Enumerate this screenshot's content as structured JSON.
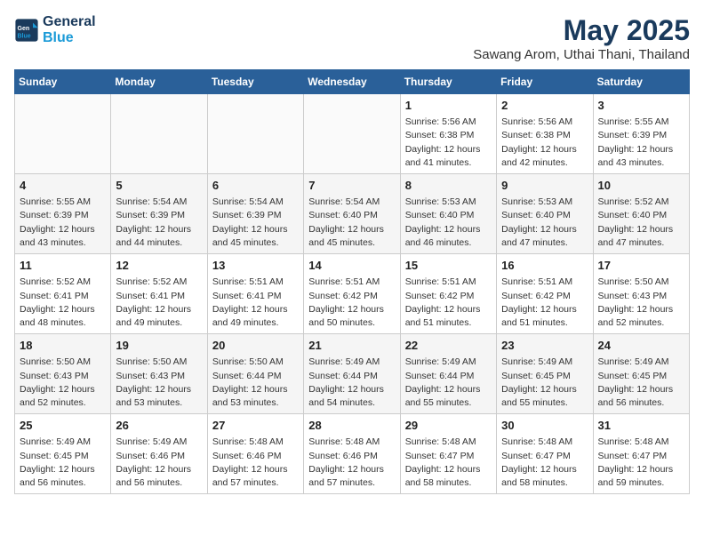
{
  "header": {
    "logo_line1": "General",
    "logo_line2": "Blue",
    "title": "May 2025",
    "subtitle": "Sawang Arom, Uthai Thani, Thailand"
  },
  "weekdays": [
    "Sunday",
    "Monday",
    "Tuesday",
    "Wednesday",
    "Thursday",
    "Friday",
    "Saturday"
  ],
  "weeks": [
    [
      {
        "day": "",
        "info": ""
      },
      {
        "day": "",
        "info": ""
      },
      {
        "day": "",
        "info": ""
      },
      {
        "day": "",
        "info": ""
      },
      {
        "day": "1",
        "info": "Sunrise: 5:56 AM\nSunset: 6:38 PM\nDaylight: 12 hours\nand 41 minutes."
      },
      {
        "day": "2",
        "info": "Sunrise: 5:56 AM\nSunset: 6:38 PM\nDaylight: 12 hours\nand 42 minutes."
      },
      {
        "day": "3",
        "info": "Sunrise: 5:55 AM\nSunset: 6:39 PM\nDaylight: 12 hours\nand 43 minutes."
      }
    ],
    [
      {
        "day": "4",
        "info": "Sunrise: 5:55 AM\nSunset: 6:39 PM\nDaylight: 12 hours\nand 43 minutes."
      },
      {
        "day": "5",
        "info": "Sunrise: 5:54 AM\nSunset: 6:39 PM\nDaylight: 12 hours\nand 44 minutes."
      },
      {
        "day": "6",
        "info": "Sunrise: 5:54 AM\nSunset: 6:39 PM\nDaylight: 12 hours\nand 45 minutes."
      },
      {
        "day": "7",
        "info": "Sunrise: 5:54 AM\nSunset: 6:40 PM\nDaylight: 12 hours\nand 45 minutes."
      },
      {
        "day": "8",
        "info": "Sunrise: 5:53 AM\nSunset: 6:40 PM\nDaylight: 12 hours\nand 46 minutes."
      },
      {
        "day": "9",
        "info": "Sunrise: 5:53 AM\nSunset: 6:40 PM\nDaylight: 12 hours\nand 47 minutes."
      },
      {
        "day": "10",
        "info": "Sunrise: 5:52 AM\nSunset: 6:40 PM\nDaylight: 12 hours\nand 47 minutes."
      }
    ],
    [
      {
        "day": "11",
        "info": "Sunrise: 5:52 AM\nSunset: 6:41 PM\nDaylight: 12 hours\nand 48 minutes."
      },
      {
        "day": "12",
        "info": "Sunrise: 5:52 AM\nSunset: 6:41 PM\nDaylight: 12 hours\nand 49 minutes."
      },
      {
        "day": "13",
        "info": "Sunrise: 5:51 AM\nSunset: 6:41 PM\nDaylight: 12 hours\nand 49 minutes."
      },
      {
        "day": "14",
        "info": "Sunrise: 5:51 AM\nSunset: 6:42 PM\nDaylight: 12 hours\nand 50 minutes."
      },
      {
        "day": "15",
        "info": "Sunrise: 5:51 AM\nSunset: 6:42 PM\nDaylight: 12 hours\nand 51 minutes."
      },
      {
        "day": "16",
        "info": "Sunrise: 5:51 AM\nSunset: 6:42 PM\nDaylight: 12 hours\nand 51 minutes."
      },
      {
        "day": "17",
        "info": "Sunrise: 5:50 AM\nSunset: 6:43 PM\nDaylight: 12 hours\nand 52 minutes."
      }
    ],
    [
      {
        "day": "18",
        "info": "Sunrise: 5:50 AM\nSunset: 6:43 PM\nDaylight: 12 hours\nand 52 minutes."
      },
      {
        "day": "19",
        "info": "Sunrise: 5:50 AM\nSunset: 6:43 PM\nDaylight: 12 hours\nand 53 minutes."
      },
      {
        "day": "20",
        "info": "Sunrise: 5:50 AM\nSunset: 6:44 PM\nDaylight: 12 hours\nand 53 minutes."
      },
      {
        "day": "21",
        "info": "Sunrise: 5:49 AM\nSunset: 6:44 PM\nDaylight: 12 hours\nand 54 minutes."
      },
      {
        "day": "22",
        "info": "Sunrise: 5:49 AM\nSunset: 6:44 PM\nDaylight: 12 hours\nand 55 minutes."
      },
      {
        "day": "23",
        "info": "Sunrise: 5:49 AM\nSunset: 6:45 PM\nDaylight: 12 hours\nand 55 minutes."
      },
      {
        "day": "24",
        "info": "Sunrise: 5:49 AM\nSunset: 6:45 PM\nDaylight: 12 hours\nand 56 minutes."
      }
    ],
    [
      {
        "day": "25",
        "info": "Sunrise: 5:49 AM\nSunset: 6:45 PM\nDaylight: 12 hours\nand 56 minutes."
      },
      {
        "day": "26",
        "info": "Sunrise: 5:49 AM\nSunset: 6:46 PM\nDaylight: 12 hours\nand 56 minutes."
      },
      {
        "day": "27",
        "info": "Sunrise: 5:48 AM\nSunset: 6:46 PM\nDaylight: 12 hours\nand 57 minutes."
      },
      {
        "day": "28",
        "info": "Sunrise: 5:48 AM\nSunset: 6:46 PM\nDaylight: 12 hours\nand 57 minutes."
      },
      {
        "day": "29",
        "info": "Sunrise: 5:48 AM\nSunset: 6:47 PM\nDaylight: 12 hours\nand 58 minutes."
      },
      {
        "day": "30",
        "info": "Sunrise: 5:48 AM\nSunset: 6:47 PM\nDaylight: 12 hours\nand 58 minutes."
      },
      {
        "day": "31",
        "info": "Sunrise: 5:48 AM\nSunset: 6:47 PM\nDaylight: 12 hours\nand 59 minutes."
      }
    ]
  ]
}
